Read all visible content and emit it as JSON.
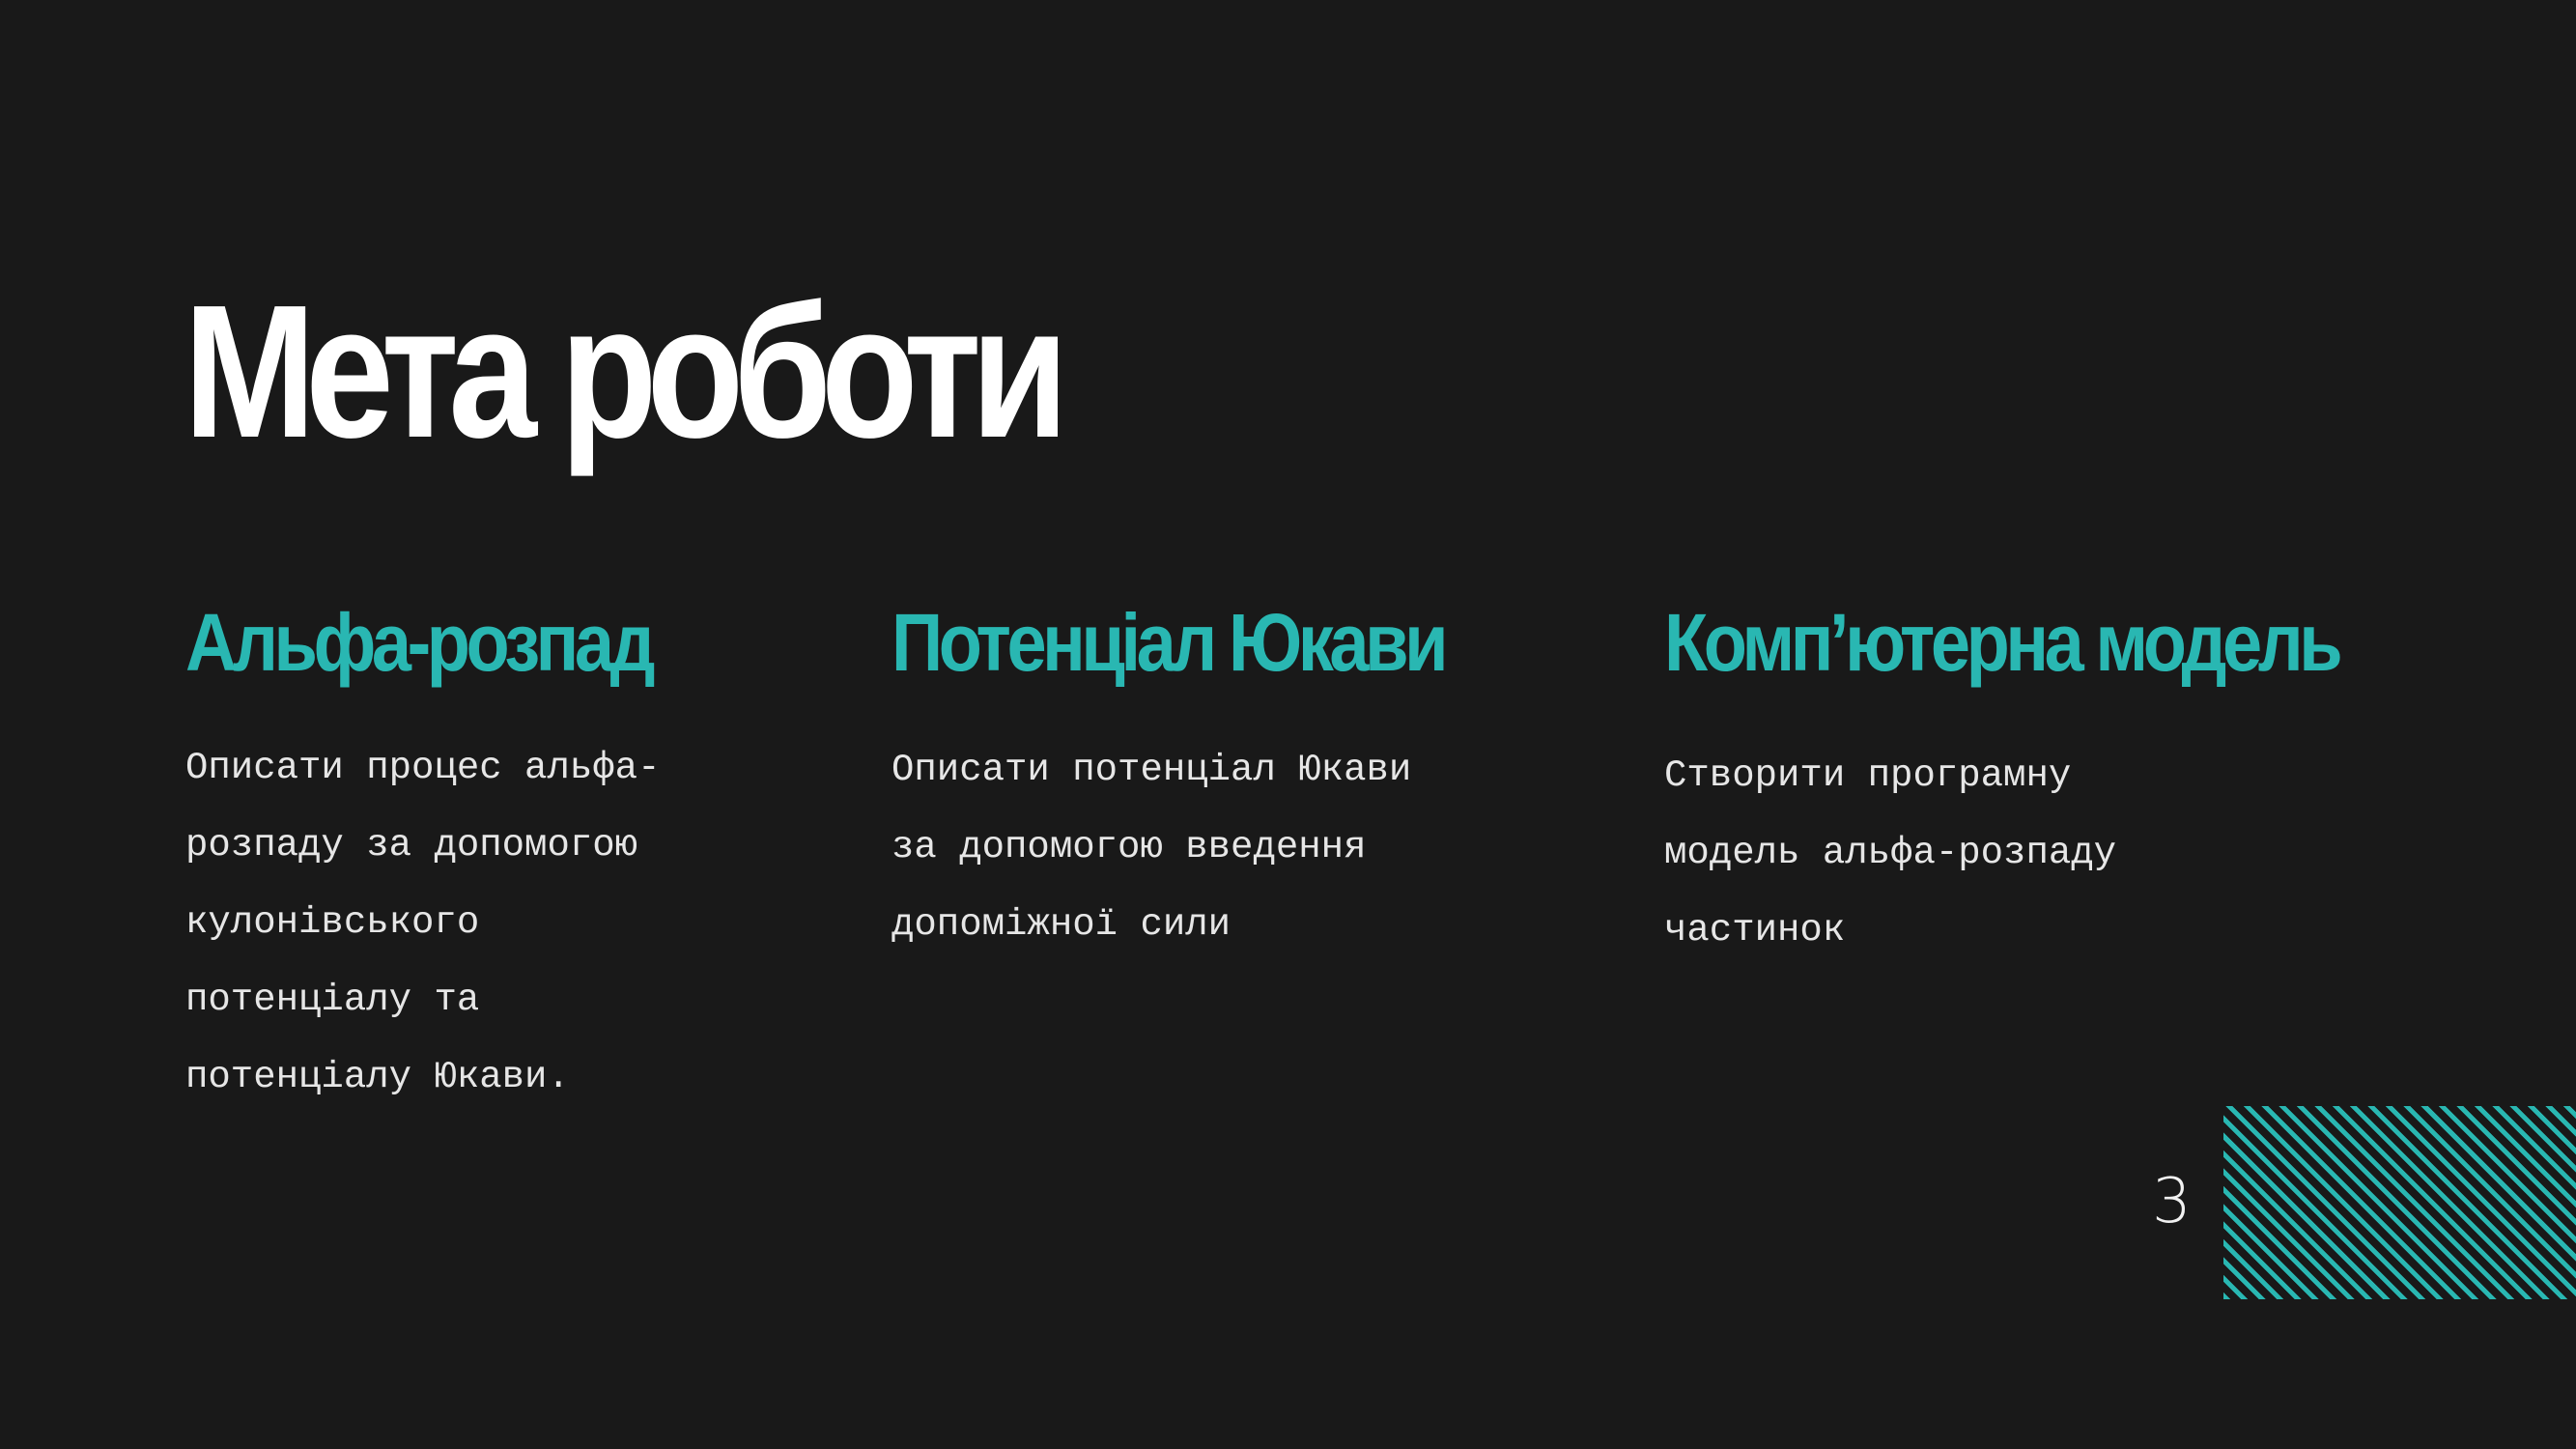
{
  "slide": {
    "title": "Мета роботи",
    "page_number": "3",
    "accent_color": "#29b7b2",
    "background_color": "#191919",
    "columns": [
      {
        "heading": "Альфа-розпад",
        "text": "Описати процес альфа-\nрозпаду за допомогою\nкулонівського\nпотенціалу та\nпотенціалу Юкави."
      },
      {
        "heading": "Потенціал Юкави",
        "text": "Описати потенціал Юкави\nза допомогою введення\nдопоміжної сили"
      },
      {
        "heading": "Комп’ютерна модель",
        "text": "Створити програмну\nмодель альфа-розпаду\nчастинок"
      }
    ]
  }
}
